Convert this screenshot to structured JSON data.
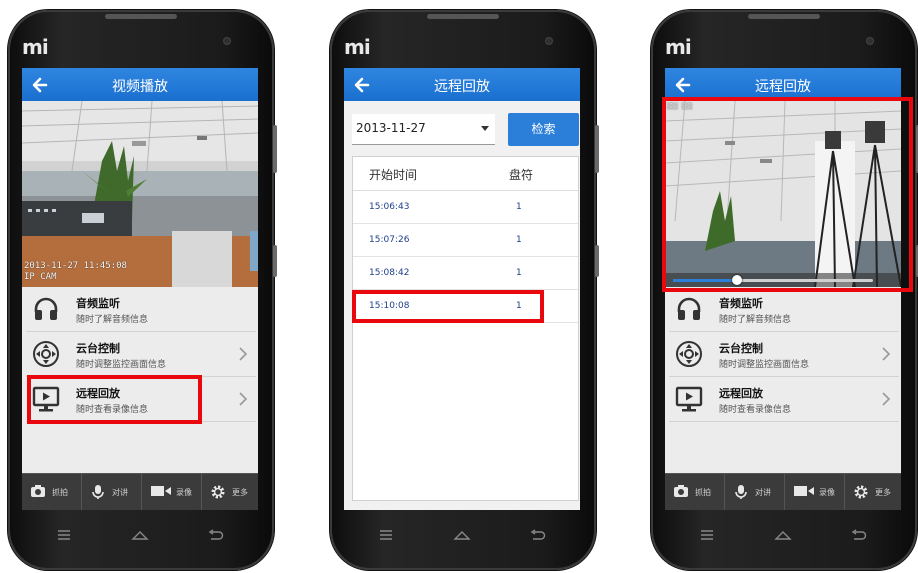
{
  "phones": {
    "left": {
      "logo": "mi",
      "title": "视频播放",
      "osd_time": "2013-11-27 11:45:08",
      "osd_cam": "IP CAM",
      "menu": [
        {
          "title": "音频监听",
          "subtitle": "随时了解音频信息",
          "icon": "headphones-icon"
        },
        {
          "title": "云台控制",
          "subtitle": "随时调整监控画面信息",
          "icon": "ptz-control-icon"
        },
        {
          "title": "远程回放",
          "subtitle": "随时查看录像信息",
          "icon": "playback-monitor-icon"
        }
      ],
      "toolbar": [
        {
          "label": "抓拍",
          "icon": "camera-icon"
        },
        {
          "label": "对讲",
          "icon": "microphone-icon"
        },
        {
          "label": "录像",
          "icon": "video-record-icon"
        },
        {
          "label": "更多",
          "icon": "gear-icon"
        }
      ]
    },
    "middle": {
      "logo": "mi",
      "title": "远程回放",
      "date": "2013-11-27",
      "search_label": "检索",
      "table_headers": [
        "开始时间",
        "盘符"
      ],
      "rows": [
        {
          "time": "15:06:43",
          "disk": "1"
        },
        {
          "time": "15:07:26",
          "disk": "1"
        },
        {
          "time": "15:08:42",
          "disk": "1"
        },
        {
          "time": "15:10:08",
          "disk": "1"
        }
      ]
    },
    "right": {
      "logo": "mi",
      "title": "远程回放",
      "playback_progress": 0.32,
      "menu": [
        {
          "title": "音频监听",
          "subtitle": "随时了解音频信息",
          "icon": "headphones-icon"
        },
        {
          "title": "云台控制",
          "subtitle": "随时调整监控画面信息",
          "icon": "ptz-control-icon"
        },
        {
          "title": "远程回放",
          "subtitle": "随时查看录像信息",
          "icon": "playback-monitor-icon"
        }
      ],
      "toolbar": [
        {
          "label": "抓拍",
          "icon": "camera-icon"
        },
        {
          "label": "对讲",
          "icon": "microphone-icon"
        },
        {
          "label": "录像",
          "icon": "video-record-icon"
        },
        {
          "label": "更多",
          "icon": "gear-icon"
        }
      ]
    }
  },
  "colors": {
    "navbar": "#1a6fcf",
    "highlight": "#e8080d",
    "button": "#2b7fd9",
    "toolbar": "#3b3b3b"
  }
}
